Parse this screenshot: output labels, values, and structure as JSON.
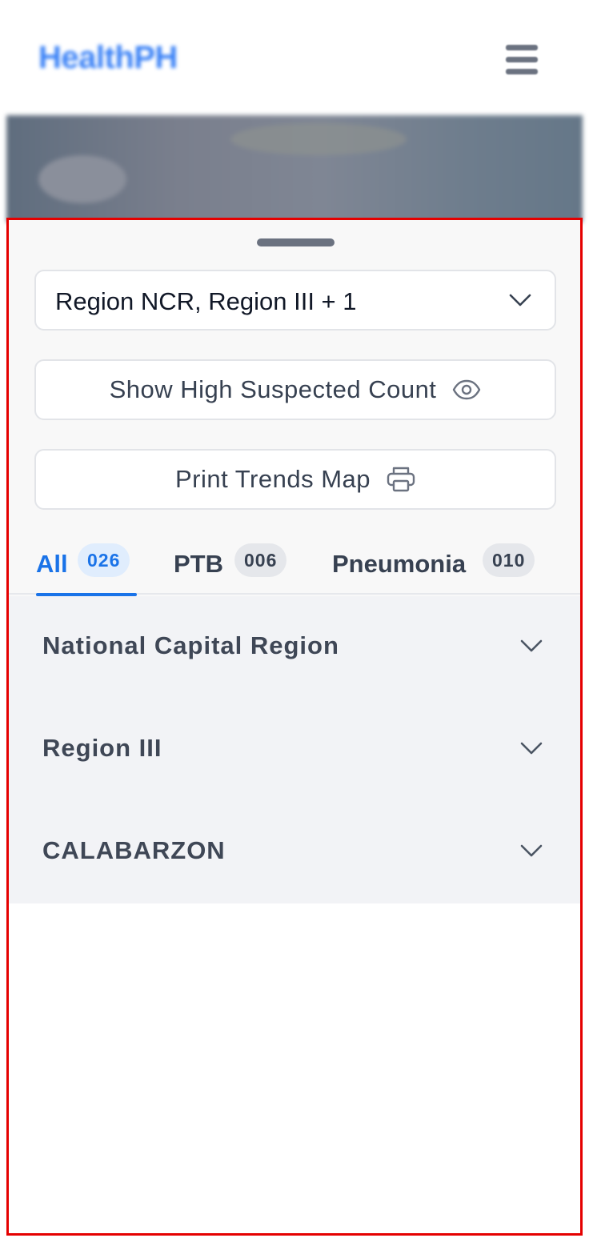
{
  "header": {
    "logo_text": "HealthPH",
    "menu_icon": "hamburger-menu-icon"
  },
  "filters": {
    "region_select_value": "Region NCR, Region III + 1",
    "high_suspected_label": "Show High Suspected Count",
    "high_suspected_icon": "eye-icon",
    "print_label": "Print Trends Map",
    "print_icon": "printer-icon"
  },
  "tabs": [
    {
      "label": "All",
      "count": "026",
      "active": true
    },
    {
      "label": "PTB",
      "count": "006",
      "active": false
    },
    {
      "label": "Pneumonia",
      "count": "010",
      "active": false
    }
  ],
  "regions": [
    {
      "name": "National Capital Region"
    },
    {
      "name": "Region III"
    },
    {
      "name": "CALABARZON"
    }
  ],
  "colors": {
    "accent": "#1a73e8",
    "highlight_border": "#e50000",
    "text_primary": "#111827",
    "text_secondary": "#374151"
  }
}
